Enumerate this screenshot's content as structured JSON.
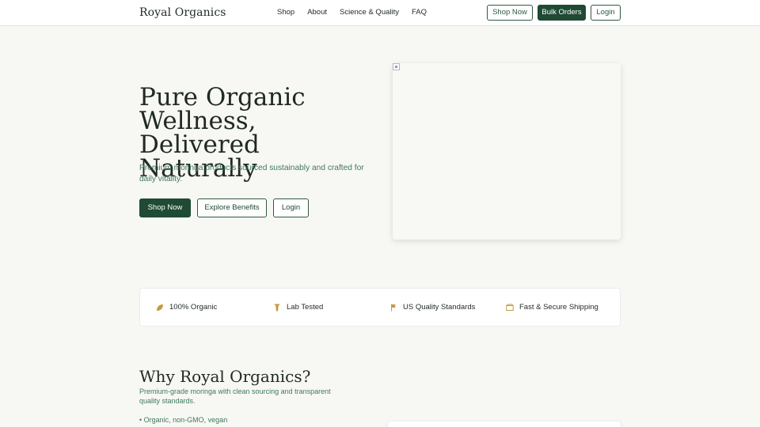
{
  "header": {
    "brand": "Royal Organics",
    "nav": [
      "Shop",
      "About",
      "Science & Quality",
      "FAQ"
    ],
    "shop_now": "Shop Now",
    "bulk_orders": "Bulk Orders",
    "login": "Login"
  },
  "hero": {
    "title": "Pure Organic Wellness, Delivered Naturally",
    "subtitle": "Premium moringa products sourced sustainably and crafted for daily vitality.",
    "buttons": {
      "shop_now": "Shop Now",
      "explore": "Explore Benefits",
      "login": "Login"
    }
  },
  "features": [
    {
      "label": "100% Organic",
      "icon": "leaf-icon"
    },
    {
      "label": "Lab Tested",
      "icon": "test-tube-icon"
    },
    {
      "label": "US Quality Standards",
      "icon": "flag-icon"
    },
    {
      "label": "Fast & Secure Shipping",
      "icon": "package-icon"
    }
  ],
  "why": {
    "title": "Why Royal Organics?",
    "subtitle": "Premium-grade moringa with clean sourcing and transparent quality standards.",
    "bullet": "• Organic, non-GMO, vegan"
  },
  "colors": {
    "accent": "#1f4a33",
    "subtext": "#3f7a5a",
    "icon": "#c79a3a"
  }
}
